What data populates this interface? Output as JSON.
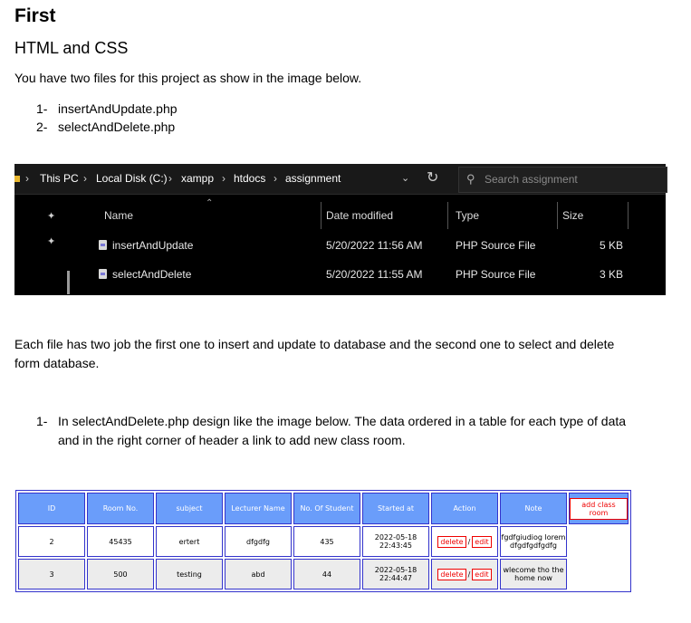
{
  "heading": "First",
  "subheading": "HTML and CSS",
  "intro": "You have two files for this project as show in the image below.",
  "files_list": [
    {
      "num": "1-",
      "text": "insertAndUpdate.php"
    },
    {
      "num": "2-",
      "text": "selectAndDelete.php"
    }
  ],
  "explorer": {
    "breadcrumb": [
      "This PC",
      "Local Disk (C:)",
      "xampp",
      "htdocs",
      "assignment"
    ],
    "search_placeholder": "Search assignment",
    "columns": {
      "name": "Name",
      "date": "Date modified",
      "type": "Type",
      "size": "Size"
    },
    "files": [
      {
        "name": "insertAndUpdate",
        "date": "5/20/2022 11:56 AM",
        "type": "PHP Source File",
        "size": "5 KB"
      },
      {
        "name": "selectAndDelete",
        "date": "5/20/2022 11:55 AM",
        "type": "PHP Source File",
        "size": "3 KB"
      }
    ],
    "icons": {
      "folder": "folder-icon",
      "refresh": "refresh-icon",
      "search": "search-icon",
      "pin": "pin-icon",
      "file": "php-file-icon"
    }
  },
  "para2_line1": "Each file has two job the first one to insert and update to database and the second one to select and delete",
  "para2_line2": "form database.",
  "task": {
    "num": "1-",
    "line1": "In selectAndDelete.php design like the image below. The data ordered in a table for each type of data",
    "line2": "and in the right corner of header a link to add new class room."
  },
  "table": {
    "headers": [
      "ID",
      "Room No.",
      "subject",
      "Lecturer Name",
      "No. Of Student",
      "Started at",
      "Action",
      "Note"
    ],
    "add_link": "add class room",
    "delete_label": "delete",
    "edit_label": "edit",
    "separator": "/",
    "rows": [
      {
        "id": "2",
        "room": "45435",
        "subject": "ertert",
        "lecturer": "dfgdfg",
        "students": "435",
        "started_date": "2022-05-18",
        "started_time": "22:43:45",
        "note_line1": "fgdfgiudiog lorem",
        "note_line2": "dfgdfgdfgdfg"
      },
      {
        "id": "3",
        "room": "500",
        "subject": "testing",
        "lecturer": "abd",
        "students": "44",
        "started_date": "2022-05-18",
        "started_time": "22:44:47",
        "note_line1": "wlecome tho the",
        "note_line2": "home now"
      }
    ],
    "colors": {
      "header_bg": "#6a9dfa",
      "border": "#3333cc",
      "link": "#e00000",
      "row_alt": "#ececec"
    }
  }
}
